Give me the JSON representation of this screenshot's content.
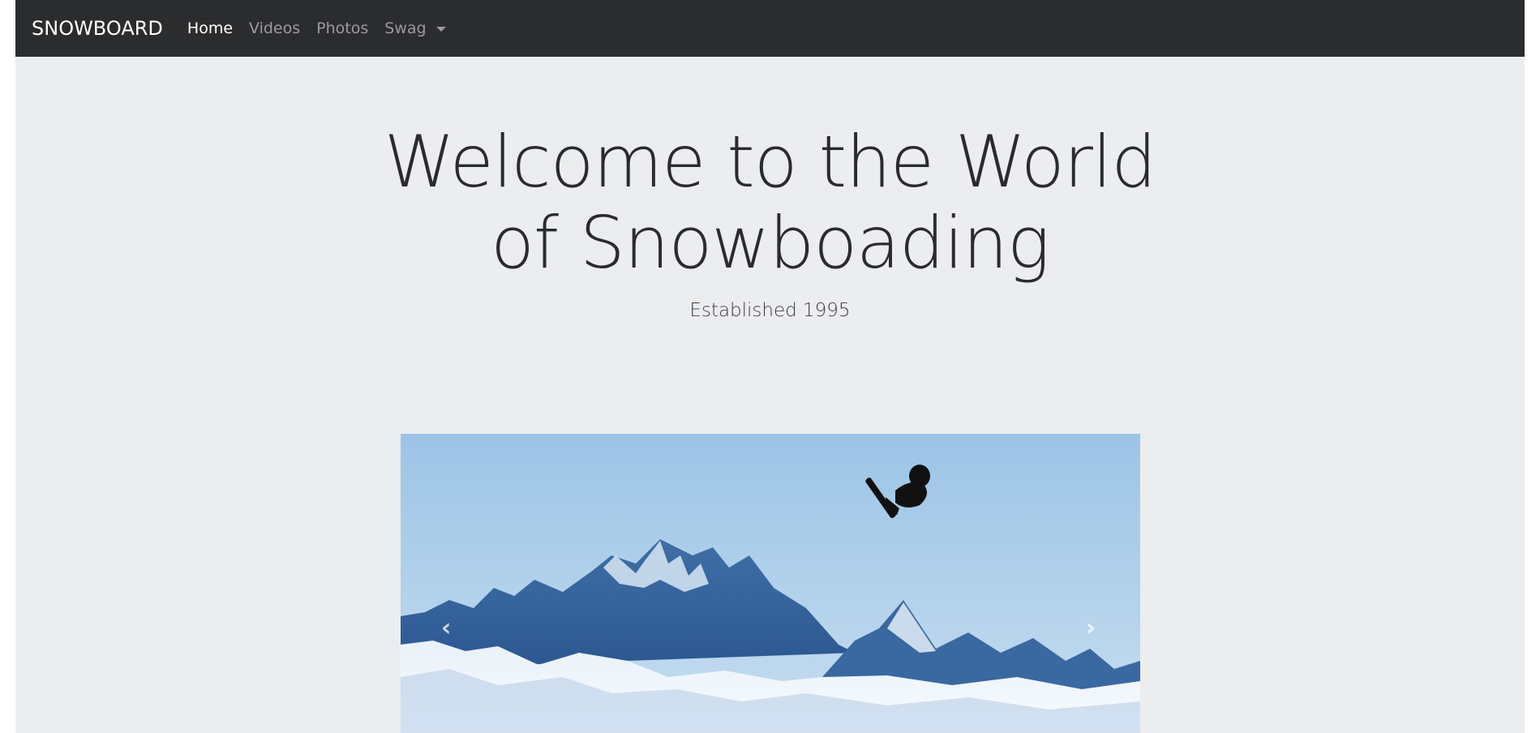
{
  "navbar": {
    "brand": "SNOWBOARD",
    "items": [
      {
        "label": "Home",
        "active": true
      },
      {
        "label": "Videos",
        "active": false
      },
      {
        "label": "Photos",
        "active": false
      },
      {
        "label": "Swag",
        "active": false,
        "dropdown": true
      }
    ]
  },
  "hero": {
    "title": "Welcome to the World of Snowboading",
    "subtitle": "Established 1995"
  },
  "carousel": {
    "slide_image": "snowboarder jumping over snowy mountains",
    "prev_icon": "chevron-left-icon",
    "next_icon": "chevron-right-icon",
    "prev_glyph": "‹",
    "next_glyph": "›"
  },
  "colors": {
    "navbar_bg": "#2b2c2e",
    "page_bg": "#ecedef",
    "nav_active": "#ffffff",
    "nav_inactive": "#9a9b9d"
  }
}
